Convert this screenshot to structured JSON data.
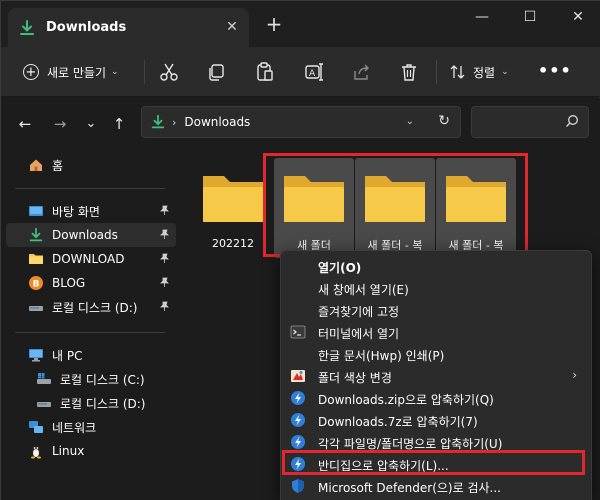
{
  "window": {
    "tab_title": "Downloads",
    "new_tab_symbol": "+",
    "minimize_symbol": "—",
    "maximize_symbol": "☐",
    "close_symbol": "✕",
    "tab_close_symbol": "✕"
  },
  "toolbar": {
    "new_label": "새로 만들기",
    "sort_label": "정렬",
    "more_label": "•••",
    "buttons": [
      "cut-icon",
      "copy-icon",
      "paste-icon",
      "rename-icon",
      "share-icon",
      "delete-icon"
    ]
  },
  "navigation": {
    "back": "←",
    "forward": "→",
    "recent": "⌄",
    "up": "↑",
    "address_separator": "›",
    "address_path": "Downloads",
    "address_dropdown": "⌄",
    "refresh": "↻",
    "search_placeholder": ""
  },
  "sidebar": {
    "home": "홈",
    "quick_access": [
      {
        "label": "바탕 화면",
        "icon": "desktop-icon",
        "pinned": true
      },
      {
        "label": "Downloads",
        "icon": "download-icon",
        "pinned": true,
        "active": true
      },
      {
        "label": "DOWNLOAD",
        "icon": "folder-icon",
        "pinned": true
      },
      {
        "label": "BLOG",
        "icon": "blogger-icon",
        "pinned": true
      },
      {
        "label": "로컬 디스크 (D:)",
        "icon": "drive-icon",
        "pinned": true
      }
    ],
    "this_pc": "내 PC",
    "drives": [
      {
        "label": "로컬 디스크 (C:)",
        "icon": "windows-drive-icon"
      },
      {
        "label": "로컬 디스크 (D:)",
        "icon": "drive-icon"
      }
    ],
    "network": "네트워크",
    "linux": "Linux"
  },
  "files": [
    {
      "name": "202212",
      "selected": false
    },
    {
      "name": "새 폴더",
      "selected": true
    },
    {
      "name": "새 폴더 - 복",
      "selected": true
    },
    {
      "name": "새 폴더 - 복",
      "selected": true
    }
  ],
  "context_menu": {
    "items": [
      {
        "label": "열기(O)",
        "bold": true,
        "icon": ""
      },
      {
        "label": "새 창에서 열기(E)",
        "icon": ""
      },
      {
        "label": "즐겨찾기에 고정",
        "icon": ""
      },
      {
        "label": "터미널에서 열기",
        "icon": "terminal-icon"
      },
      {
        "label": "한글 문서(Hwp) 인쇄(P)",
        "icon": ""
      },
      {
        "label": "폴더 색상 변경",
        "icon": "folder-color-icon",
        "submenu": true
      },
      {
        "label": "Downloads.zip으로 압축하기(Q)",
        "icon": "bandizip-icon"
      },
      {
        "label": "Downloads.7z로 압축하기(7)",
        "icon": "bandizip-icon"
      },
      {
        "label": "각각 파일명/폴더명으로 압축하기(U)",
        "icon": "bandizip-icon"
      },
      {
        "label": "반디집으로 압축하기(L)...",
        "icon": "bandizip-icon"
      },
      {
        "label": "Microsoft Defender(으)로 검사...",
        "icon": "defender-shield-icon"
      }
    ],
    "submenu_arrow": "›"
  },
  "colors": {
    "accent_green": "#3fbf7f",
    "folder_yellow": "#f7c948",
    "highlight_red": "#e0282e",
    "selection_gray": "#4a4a4a"
  }
}
